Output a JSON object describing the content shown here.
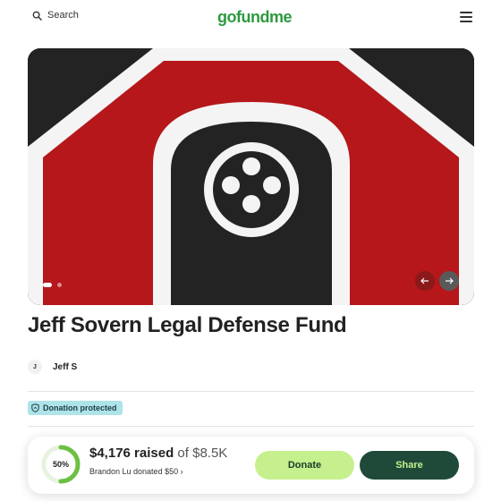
{
  "header": {
    "search_label": "Search",
    "logo_text": "gofundme",
    "icons": {
      "search": "search-icon",
      "menu": "hamburger-menu-icon"
    }
  },
  "hero": {
    "image": "red-octagon-dark-tag-emblem",
    "carousel_slides": 2,
    "active_slide": 1,
    "colors": {
      "red": "#b5171a",
      "dark": "#232323",
      "white": "#f4f4f4"
    }
  },
  "campaign": {
    "title": "Jeff Sovern Legal Defense Fund",
    "organizer": {
      "initial": "J",
      "name": "Jeff S"
    },
    "badge": "Donation protected"
  },
  "progress": {
    "percent": 50,
    "percent_label": "50%",
    "raised": "$4,176 raised",
    "goal": "of $8.5K",
    "recent_donation": "Brandon Lu donated $50"
  },
  "actions": {
    "donate_label": "Donate",
    "share_label": "Share"
  },
  "colors": {
    "brand_green": "#2c9a3f",
    "donate_bg": "#c5f08d",
    "share_bg": "#1f4a3a",
    "badge_bg": "#aee3ea"
  }
}
